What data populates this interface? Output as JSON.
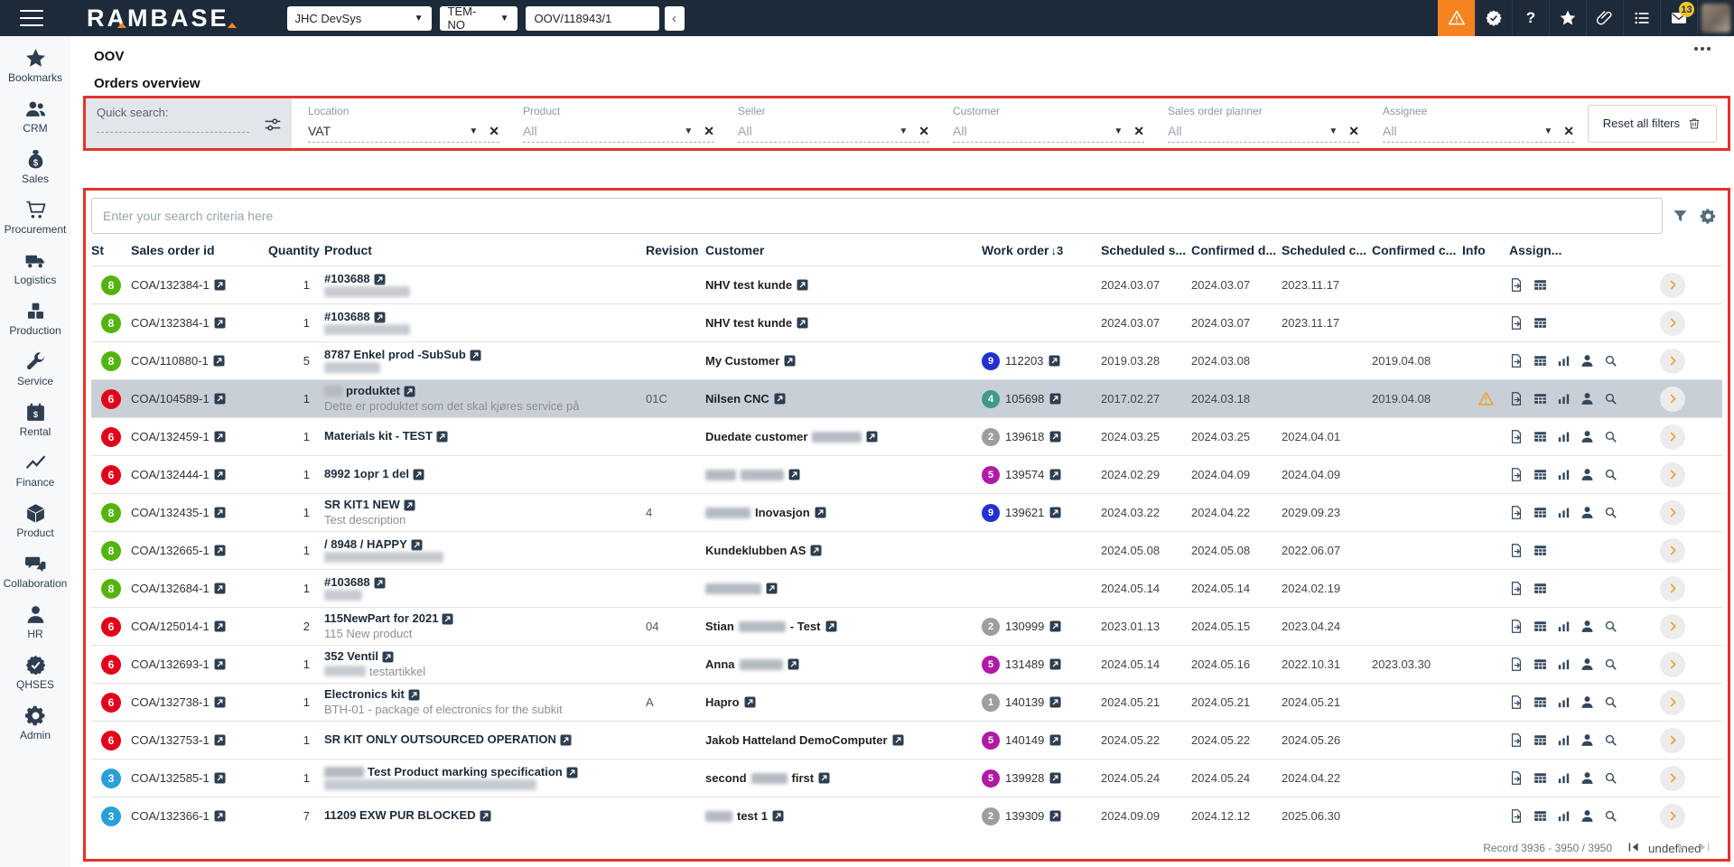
{
  "topbar": {
    "logo_text": "RAMBASE",
    "system_select": {
      "value": "JHC DevSys"
    },
    "company_select": {
      "value": "TEM-NO"
    },
    "document_input": {
      "value": "OOV/118943/1"
    },
    "back_button": "‹",
    "icons": [
      {
        "name": "alert",
        "badge": "",
        "highlighted": true
      },
      {
        "name": "approvals",
        "badge": "",
        "highlighted": false
      },
      {
        "name": "help",
        "badge": "",
        "highlighted": false
      },
      {
        "name": "favorites",
        "badge": "",
        "highlighted": false
      },
      {
        "name": "attachments",
        "badge": "",
        "highlighted": false
      },
      {
        "name": "task-list",
        "badge": "",
        "highlighted": false
      },
      {
        "name": "mail",
        "badge": "13",
        "highlighted": false
      },
      {
        "name": "avatar",
        "badge": "",
        "highlighted": false
      }
    ]
  },
  "sidebar": {
    "items": [
      {
        "label": "Bookmarks",
        "icon": "star"
      },
      {
        "label": "CRM",
        "icon": "users"
      },
      {
        "label": "Sales",
        "icon": "money-bag"
      },
      {
        "label": "Procurement",
        "icon": "cart"
      },
      {
        "label": "Logistics",
        "icon": "truck"
      },
      {
        "label": "Production",
        "icon": "boxes"
      },
      {
        "label": "Service",
        "icon": "wrench"
      },
      {
        "label": "Rental",
        "icon": "calendar-dollar"
      },
      {
        "label": "Finance",
        "icon": "chart-line"
      },
      {
        "label": "Product",
        "icon": "cube"
      },
      {
        "label": "Collaboration",
        "icon": "chat"
      },
      {
        "label": "HR",
        "icon": "person"
      },
      {
        "label": "QHSES",
        "icon": "seal-check"
      },
      {
        "label": "Admin",
        "icon": "gear"
      }
    ]
  },
  "page": {
    "app_code": "OOV",
    "title": "Orders overview"
  },
  "filters": {
    "quick_search_label": "Quick search:",
    "fields": [
      {
        "label": "Location",
        "value": "VAT",
        "muted": false
      },
      {
        "label": "Product",
        "value": "All",
        "muted": true
      },
      {
        "label": "Seller",
        "value": "All",
        "muted": true
      },
      {
        "label": "Customer",
        "value": "All",
        "muted": true
      },
      {
        "label": "Sales order planner",
        "value": "All",
        "muted": true
      },
      {
        "label": "Assignee",
        "value": "All",
        "muted": true
      }
    ],
    "reset_button": "Reset all filters"
  },
  "search": {
    "placeholder": "Enter your search criteria here"
  },
  "table": {
    "columns": [
      "St",
      "Sales order id",
      "Quantity",
      "Product",
      "Revision",
      "Customer",
      "Work order",
      "Scheduled s...",
      "Confirmed d...",
      "Scheduled c...",
      "Confirmed c...",
      "Info",
      "Assign..."
    ],
    "sort": {
      "column": "Work order",
      "direction": "descending",
      "order": "3"
    },
    "status_colors": {
      "8": "#54b40f",
      "6": "#e2001a",
      "3": "#2a9fd8"
    },
    "wo_colors": {
      "blue": "#2232d2",
      "teal": "#3f9a8c",
      "grey": "#9e9e9e",
      "purple": "#b01ba5"
    },
    "rows": [
      {
        "status": "8",
        "id": "COA/132384-1",
        "qty": "1",
        "product_name": [
          {
            "t": "#103688"
          }
        ],
        "product_desc": [
          {
            "r": 95
          }
        ],
        "revision": "",
        "customer": [
          {
            "t": "NHV test kunde"
          }
        ],
        "wo": null,
        "scheduled_start": "2024.03.07",
        "confirmed_delivery": "2024.03.07",
        "scheduled_completion": "2023.11.17",
        "confirmed_completion": "",
        "warning": false,
        "selected": false
      },
      {
        "status": "8",
        "id": "COA/132384-1",
        "qty": "1",
        "product_name": [
          {
            "t": "#103688"
          }
        ],
        "product_desc": [
          {
            "r": 95
          }
        ],
        "revision": "",
        "customer": [
          {
            "t": "NHV test kunde"
          }
        ],
        "wo": null,
        "scheduled_start": "2024.03.07",
        "confirmed_delivery": "2024.03.07",
        "scheduled_completion": "2023.11.17",
        "confirmed_completion": "",
        "warning": false,
        "selected": false
      },
      {
        "status": "8",
        "id": "COA/110880-1",
        "qty": "5",
        "product_name": [
          {
            "t": "8787 Enkel prod -SubSub"
          }
        ],
        "product_desc": [
          {
            "r": 62
          }
        ],
        "revision": "",
        "customer": [
          {
            "t": "My Customer"
          }
        ],
        "wo": {
          "status": "9",
          "color": "blue",
          "id": "112203"
        },
        "scheduled_start": "2019.03.28",
        "confirmed_delivery": "2024.03.08",
        "scheduled_completion": "",
        "confirmed_completion": "2019.04.08",
        "warning": false,
        "selected": false
      },
      {
        "status": "6",
        "id": "COA/104589-1",
        "qty": "1",
        "product_name": [
          {
            "r": 20
          },
          {
            "t": "produktet"
          }
        ],
        "product_desc": [
          {
            "t": "Dette er produktet som det skal kjøres service på"
          }
        ],
        "revision": "01C",
        "customer": [
          {
            "t": "Nilsen CNC"
          }
        ],
        "wo": {
          "status": "4",
          "color": "teal",
          "id": "105698"
        },
        "scheduled_start": "2017.02.27",
        "confirmed_delivery": "2024.03.18",
        "scheduled_completion": "",
        "confirmed_completion": "2019.04.08",
        "warning": true,
        "selected": true
      },
      {
        "status": "6",
        "id": "COA/132459-1",
        "qty": "1",
        "product_name": [
          {
            "t": "Materials kit - TEST"
          }
        ],
        "product_desc": [],
        "revision": "",
        "customer": [
          {
            "t": "Duedate customer"
          },
          {
            "r": 55
          }
        ],
        "wo": {
          "status": "2",
          "color": "grey",
          "id": "139618"
        },
        "scheduled_start": "2024.03.25",
        "confirmed_delivery": "2024.03.25",
        "scheduled_completion": "2024.04.01",
        "confirmed_completion": "",
        "warning": false,
        "selected": false
      },
      {
        "status": "6",
        "id": "COA/132444-1",
        "qty": "1",
        "product_name": [
          {
            "t": "8992 1opr 1 del"
          }
        ],
        "product_desc": [],
        "revision": "",
        "customer": [
          {
            "r": 34
          },
          {
            "r": 48
          }
        ],
        "wo": {
          "status": "5",
          "color": "purple",
          "id": "139574"
        },
        "scheduled_start": "2024.02.29",
        "confirmed_delivery": "2024.04.09",
        "scheduled_completion": "2024.04.09",
        "confirmed_completion": "",
        "warning": false,
        "selected": false
      },
      {
        "status": "8",
        "id": "COA/132435-1",
        "qty": "1",
        "product_name": [
          {
            "t": "SR KIT1 NEW"
          }
        ],
        "product_desc": [
          {
            "t": "Test description"
          }
        ],
        "revision": "4",
        "customer": [
          {
            "r": 50
          },
          {
            "t": "Inovasjon"
          }
        ],
        "wo": {
          "status": "9",
          "color": "blue",
          "id": "139621"
        },
        "scheduled_start": "2024.03.22",
        "confirmed_delivery": "2024.04.22",
        "scheduled_completion": "2029.09.23",
        "confirmed_completion": "",
        "warning": false,
        "selected": false
      },
      {
        "status": "8",
        "id": "COA/132665-1",
        "qty": "1",
        "product_name": [
          {
            "t": "/ 8948 / HAPPY"
          }
        ],
        "product_desc": [
          {
            "r": 132
          }
        ],
        "revision": "",
        "customer": [
          {
            "t": "Kundeklubben AS"
          }
        ],
        "wo": null,
        "scheduled_start": "2024.05.08",
        "confirmed_delivery": "2024.05.08",
        "scheduled_completion": "2022.06.07",
        "confirmed_completion": "",
        "warning": false,
        "selected": false
      },
      {
        "status": "8",
        "id": "COA/132684-1",
        "qty": "1",
        "product_name": [
          {
            "t": "#103688"
          }
        ],
        "product_desc": [
          {
            "r": 42
          }
        ],
        "revision": "",
        "customer": [
          {
            "r": 62
          }
        ],
        "wo": null,
        "scheduled_start": "2024.05.14",
        "confirmed_delivery": "2024.05.14",
        "scheduled_completion": "2024.02.19",
        "confirmed_completion": "",
        "warning": false,
        "selected": false
      },
      {
        "status": "6",
        "id": "COA/125014-1",
        "qty": "2",
        "product_name": [
          {
            "t": "115NewPart for 2021"
          }
        ],
        "product_desc": [
          {
            "t": "115 New product"
          }
        ],
        "revision": "04",
        "customer": [
          {
            "t": "Stian"
          },
          {
            "r": 52
          },
          {
            "t": "- Test"
          }
        ],
        "wo": {
          "status": "2",
          "color": "grey",
          "id": "130999"
        },
        "scheduled_start": "2023.01.13",
        "confirmed_delivery": "2024.05.15",
        "scheduled_completion": "2023.04.24",
        "confirmed_completion": "",
        "warning": false,
        "selected": false
      },
      {
        "status": "6",
        "id": "COA/132693-1",
        "qty": "1",
        "product_name": [
          {
            "t": "352 Ventil"
          }
        ],
        "product_desc": [
          {
            "r": 46
          },
          {
            "t": "testartikkel"
          }
        ],
        "revision": "",
        "customer": [
          {
            "t": "Anna"
          },
          {
            "r": 48
          }
        ],
        "wo": {
          "status": "5",
          "color": "purple",
          "id": "131489"
        },
        "scheduled_start": "2024.05.14",
        "confirmed_delivery": "2024.05.16",
        "scheduled_completion": "2022.10.31",
        "confirmed_completion": "2023.03.30",
        "warning": false,
        "selected": false
      },
      {
        "status": "6",
        "id": "COA/132738-1",
        "qty": "1",
        "product_name": [
          {
            "t": "Electronics kit"
          }
        ],
        "product_desc": [
          {
            "t": "BTH-01 - package of electronics for the subkit"
          }
        ],
        "revision": "A",
        "customer": [
          {
            "t": "Hapro"
          }
        ],
        "wo": {
          "status": "1",
          "color": "grey",
          "id": "140139"
        },
        "scheduled_start": "2024.05.21",
        "confirmed_delivery": "2024.05.21",
        "scheduled_completion": "2024.05.21",
        "confirmed_completion": "",
        "warning": false,
        "selected": false
      },
      {
        "status": "6",
        "id": "COA/132753-1",
        "qty": "1",
        "product_name": [
          {
            "t": "SR KIT ONLY OUTSOURCED OPERATION"
          }
        ],
        "product_desc": [],
        "revision": "",
        "customer": [
          {
            "t": "Jakob Hatteland DemoComputer"
          }
        ],
        "wo": {
          "status": "5",
          "color": "purple",
          "id": "140149"
        },
        "scheduled_start": "2024.05.22",
        "confirmed_delivery": "2024.05.22",
        "scheduled_completion": "2024.05.26",
        "confirmed_completion": "",
        "warning": false,
        "selected": false
      },
      {
        "status": "3",
        "id": "COA/132585-1",
        "qty": "1",
        "product_name": [
          {
            "r": 44
          },
          {
            "t": "Test Product marking specification"
          }
        ],
        "product_desc": [
          {
            "r": 235
          }
        ],
        "revision": "",
        "customer": [
          {
            "t": "second"
          },
          {
            "r": 40
          },
          {
            "t": "first"
          }
        ],
        "wo": {
          "status": "5",
          "color": "purple",
          "id": "139928"
        },
        "scheduled_start": "2024.05.24",
        "confirmed_delivery": "2024.05.24",
        "scheduled_completion": "2024.04.22",
        "confirmed_completion": "",
        "warning": false,
        "selected": false
      },
      {
        "status": "3",
        "id": "COA/132366-1",
        "qty": "7",
        "product_name": [
          {
            "t": "11209 EXW PUR BLOCKED"
          }
        ],
        "product_desc": [],
        "revision": "",
        "customer": [
          {
            "r": 30
          },
          {
            "t": "test 1"
          }
        ],
        "wo": {
          "status": "2",
          "color": "grey",
          "id": "139309"
        },
        "scheduled_start": "2024.09.09",
        "confirmed_delivery": "2024.12.12",
        "scheduled_completion": "2025.06.30",
        "confirmed_completion": "",
        "warning": false,
        "selected": false
      }
    ]
  },
  "footer": {
    "record_text": "Record 3936 - 3950 / 3950",
    "pager": [
      {
        "name": "first-page",
        "enabled": true
      },
      {
        "name": "previous-page",
        "enabled": true
      },
      {
        "name": "next-page",
        "enabled": false
      },
      {
        "name": "last-page",
        "enabled": false
      }
    ]
  },
  "colors": {
    "topbar": "#1d2a3a",
    "accent_orange": "#f5831f",
    "panel_border_red": "#e5332b",
    "selected_row": "#c9cfd7",
    "warning": "#f0a232"
  }
}
